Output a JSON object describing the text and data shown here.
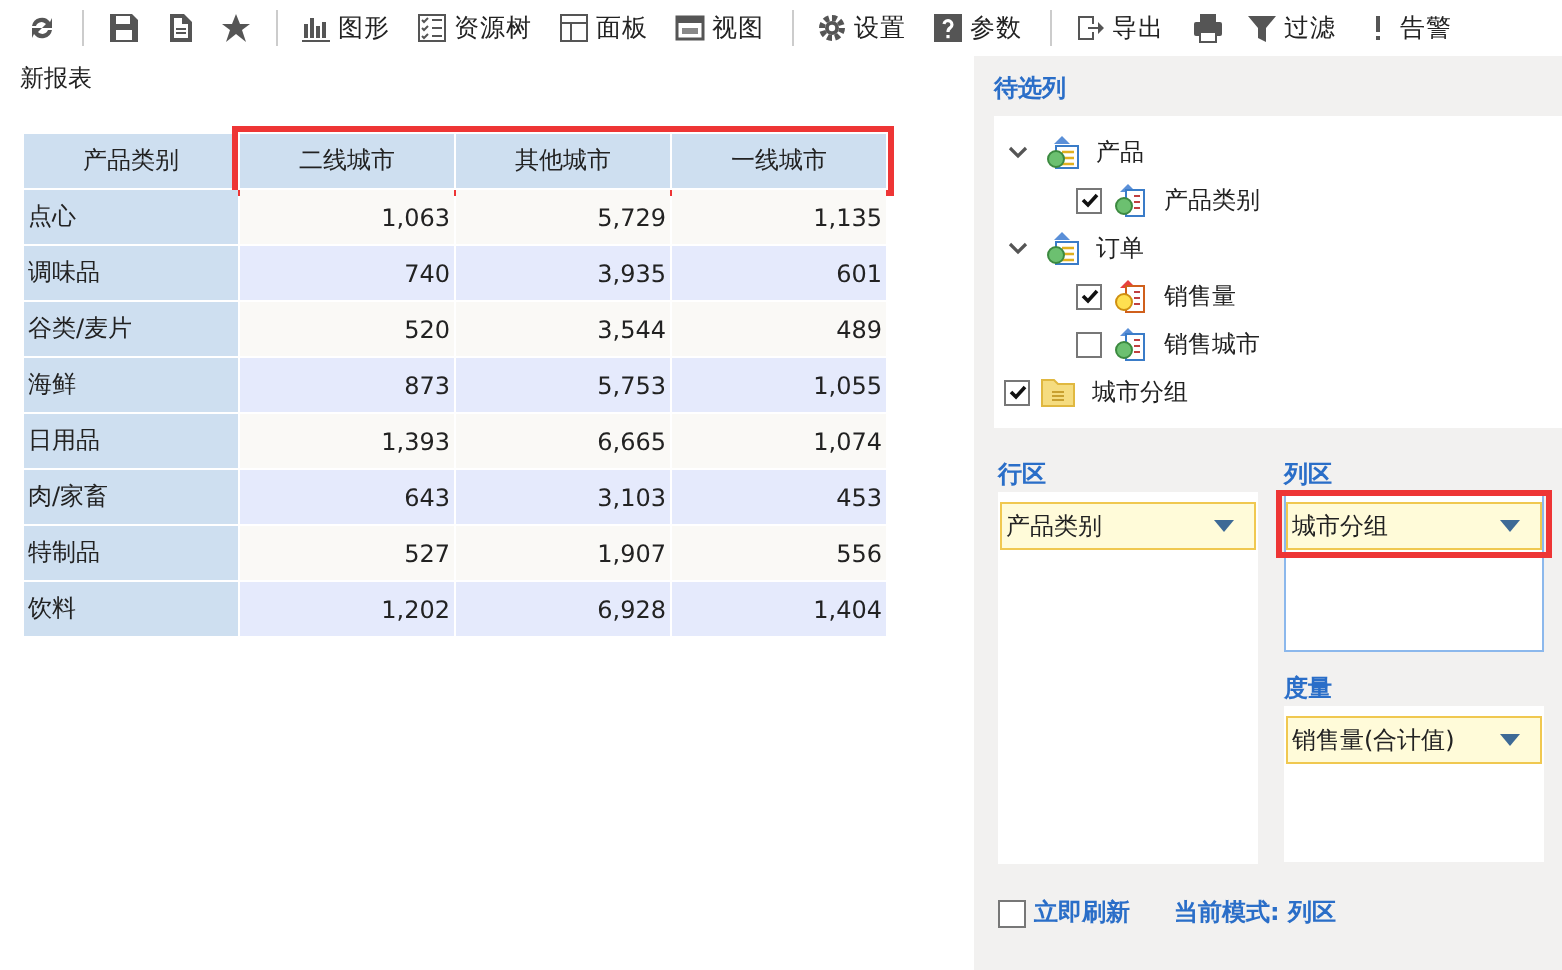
{
  "toolbar": {
    "groups": [
      {
        "items": [
          {
            "kind": "icon"
          }
        ]
      },
      {
        "items": [
          {
            "kind": "icon"
          },
          {
            "kind": "icon"
          },
          {
            "kind": "icon"
          }
        ]
      },
      {
        "items": [
          {
            "kind": "labeled",
            "label": "图形"
          },
          {
            "kind": "labeled",
            "label": "资源树"
          },
          {
            "kind": "labeled",
            "label": "面板"
          },
          {
            "kind": "labeled",
            "label": "视图"
          }
        ]
      },
      {
        "items": [
          {
            "kind": "labeled",
            "label": "设置"
          },
          {
            "kind": "labeled",
            "label": "参数"
          }
        ]
      },
      {
        "items": [
          {
            "kind": "labeled",
            "label": "导出"
          },
          {
            "kind": "icon"
          },
          {
            "kind": "labeled",
            "label": "过滤"
          },
          {
            "kind": "labeled",
            "label": "告警"
          }
        ]
      }
    ]
  },
  "report": {
    "title": "新报表",
    "table": {
      "row_header": "产品类别",
      "columns_highlighted": true,
      "columns": [
        "二线城市",
        "其他城市",
        "一线城市"
      ],
      "rows": [
        {
          "label": "点心",
          "values": [
            "1,063",
            "5,729",
            "1,135"
          ]
        },
        {
          "label": "调味品",
          "values": [
            "740",
            "3,935",
            "601"
          ]
        },
        {
          "label": "谷类/麦片",
          "values": [
            "520",
            "3,544",
            "489"
          ]
        },
        {
          "label": "海鲜",
          "values": [
            "873",
            "5,753",
            "1,055"
          ]
        },
        {
          "label": "日用品",
          "values": [
            "1,393",
            "6,665",
            "1,074"
          ]
        },
        {
          "label": "肉/家畜",
          "values": [
            "643",
            "3,103",
            "453"
          ]
        },
        {
          "label": "特制品",
          "values": [
            "527",
            "1,907",
            "556"
          ]
        },
        {
          "label": "饮料",
          "values": [
            "1,202",
            "6,928",
            "1,404"
          ]
        }
      ]
    }
  },
  "panel": {
    "title": "待选列",
    "tree": [
      {
        "kind": "table",
        "label": "产品",
        "expanded": true,
        "children": [
          {
            "kind": "dimension",
            "label": "产品类别",
            "checked": true
          }
        ]
      },
      {
        "kind": "table",
        "label": "订单",
        "expanded": true,
        "children": [
          {
            "kind": "measure",
            "label": "销售量",
            "checked": true
          },
          {
            "kind": "dimension",
            "label": "销售城市",
            "checked": false
          }
        ]
      },
      {
        "kind": "group",
        "label": "城市分组",
        "checked": true
      }
    ],
    "zones": [
      {
        "title": "行区",
        "active": false,
        "highlighted": false,
        "chips": [
          "产品类别"
        ]
      },
      {
        "title": "列区",
        "active": true,
        "highlighted": true,
        "chips": [
          "城市分组"
        ]
      },
      {
        "title": "度量",
        "active": false,
        "highlighted": false,
        "chips": [
          "销售量(合计值)"
        ]
      }
    ],
    "refresh_now": {
      "label": "立即刷新",
      "checked": false
    },
    "mode": "当前模式: 列区"
  }
}
